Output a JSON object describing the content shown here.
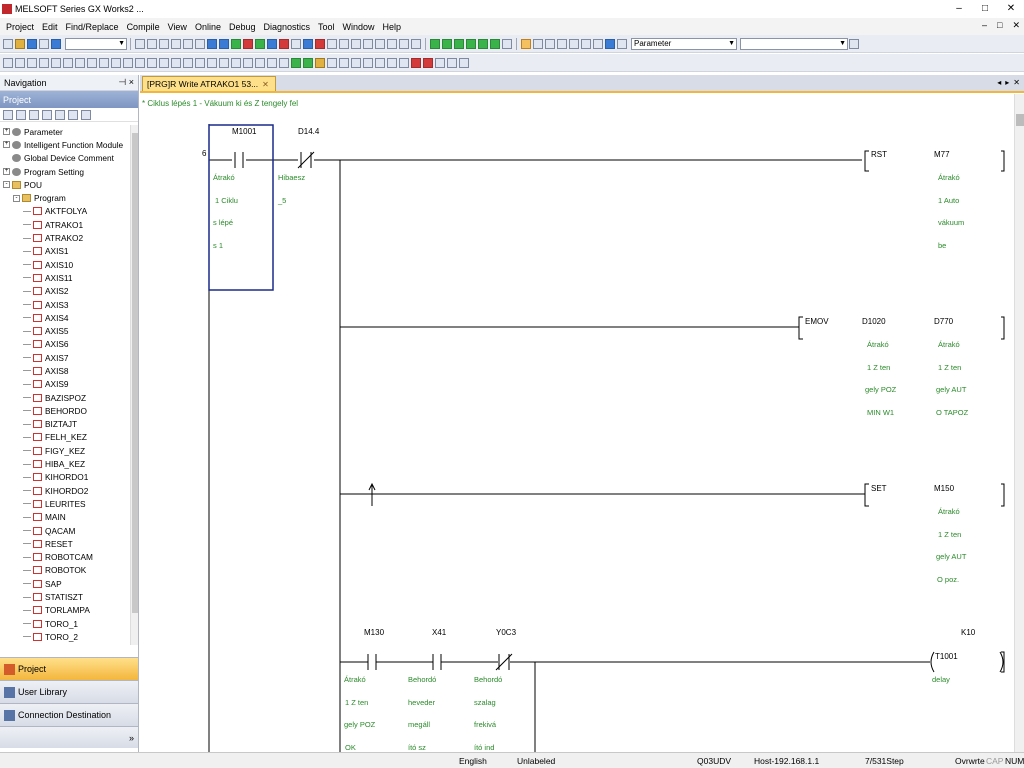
{
  "window": {
    "title": "MELSOFT Series GX Works2 ...",
    "controls": [
      "–",
      "□",
      "✕"
    ]
  },
  "menu": [
    "Project",
    "Edit",
    "Find/Replace",
    "Compile",
    "View",
    "Online",
    "Debug",
    "Diagnostics",
    "Tool",
    "Window",
    "Help"
  ],
  "menu_right": [
    "–",
    "□",
    "✕"
  ],
  "toolbar": {
    "parameter_combo": "Parameter",
    "empty_combo": ""
  },
  "navigation": {
    "title": "Navigation",
    "pin": "⊣ ×",
    "project_header": "Project",
    "tree": [
      {
        "label": "Parameter",
        "indent": 0,
        "icon": "gear",
        "expander": "+"
      },
      {
        "label": "Intelligent Function Module",
        "indent": 0,
        "icon": "gear",
        "expander": "+"
      },
      {
        "label": "Global Device Comment",
        "indent": 0,
        "icon": "gear",
        "expander": ""
      },
      {
        "label": "Program Setting",
        "indent": 0,
        "icon": "gear",
        "expander": "+"
      },
      {
        "label": "POU",
        "indent": 0,
        "icon": "folder",
        "expander": "-"
      },
      {
        "label": "Program",
        "indent": 1,
        "icon": "folder",
        "expander": "-"
      },
      {
        "label": "AKTFOLYA",
        "indent": 2,
        "icon": "prog",
        "expander": ""
      },
      {
        "label": "ATRAKO1",
        "indent": 2,
        "icon": "prog",
        "expander": ""
      },
      {
        "label": "ATRAKO2",
        "indent": 2,
        "icon": "prog",
        "expander": ""
      },
      {
        "label": "AXIS1",
        "indent": 2,
        "icon": "prog",
        "expander": ""
      },
      {
        "label": "AXIS10",
        "indent": 2,
        "icon": "prog",
        "expander": ""
      },
      {
        "label": "AXIS11",
        "indent": 2,
        "icon": "prog",
        "expander": ""
      },
      {
        "label": "AXIS2",
        "indent": 2,
        "icon": "prog",
        "expander": ""
      },
      {
        "label": "AXIS3",
        "indent": 2,
        "icon": "prog",
        "expander": ""
      },
      {
        "label": "AXIS4",
        "indent": 2,
        "icon": "prog",
        "expander": ""
      },
      {
        "label": "AXIS5",
        "indent": 2,
        "icon": "prog",
        "expander": ""
      },
      {
        "label": "AXIS6",
        "indent": 2,
        "icon": "prog",
        "expander": ""
      },
      {
        "label": "AXIS7",
        "indent": 2,
        "icon": "prog",
        "expander": ""
      },
      {
        "label": "AXIS8",
        "indent": 2,
        "icon": "prog",
        "expander": ""
      },
      {
        "label": "AXIS9",
        "indent": 2,
        "icon": "prog",
        "expander": ""
      },
      {
        "label": "BAZISPOZ",
        "indent": 2,
        "icon": "prog",
        "expander": ""
      },
      {
        "label": "BEHORDO",
        "indent": 2,
        "icon": "prog",
        "expander": ""
      },
      {
        "label": "BIZTAJT",
        "indent": 2,
        "icon": "prog",
        "expander": ""
      },
      {
        "label": "FELH_KEZ",
        "indent": 2,
        "icon": "prog",
        "expander": ""
      },
      {
        "label": "FIGY_KEZ",
        "indent": 2,
        "icon": "prog",
        "expander": ""
      },
      {
        "label": "HIBA_KEZ",
        "indent": 2,
        "icon": "prog",
        "expander": ""
      },
      {
        "label": "KIHORDO1",
        "indent": 2,
        "icon": "prog",
        "expander": ""
      },
      {
        "label": "KIHORDO2",
        "indent": 2,
        "icon": "prog",
        "expander": ""
      },
      {
        "label": "LEURITES",
        "indent": 2,
        "icon": "prog",
        "expander": ""
      },
      {
        "label": "MAIN",
        "indent": 2,
        "icon": "prog",
        "expander": ""
      },
      {
        "label": "QACAM",
        "indent": 2,
        "icon": "prog",
        "expander": ""
      },
      {
        "label": "RESET",
        "indent": 2,
        "icon": "prog",
        "expander": ""
      },
      {
        "label": "ROBOTCAM",
        "indent": 2,
        "icon": "prog",
        "expander": ""
      },
      {
        "label": "ROBOTOK",
        "indent": 2,
        "icon": "prog",
        "expander": ""
      },
      {
        "label": "SAP",
        "indent": 2,
        "icon": "prog",
        "expander": ""
      },
      {
        "label": "STATISZT",
        "indent": 2,
        "icon": "prog",
        "expander": ""
      },
      {
        "label": "TORLAMPA",
        "indent": 2,
        "icon": "prog",
        "expander": ""
      },
      {
        "label": "TORO_1",
        "indent": 2,
        "icon": "prog",
        "expander": ""
      },
      {
        "label": "TORO_2",
        "indent": 2,
        "icon": "prog",
        "expander": ""
      }
    ],
    "bottom_buttons": [
      "Project",
      "User Library",
      "Connection Destination"
    ],
    "footer_chevron": "»"
  },
  "tabs": [
    {
      "label": "[PRG]R Write ATRAKO1 53...",
      "close": "✕"
    }
  ],
  "tab_controls": [
    "◂",
    "▸",
    "✕"
  ],
  "ladder": {
    "comment": "* Ciklus lépés 1 - Vákuum ki és Z tengely fel",
    "step_number": "6",
    "contacts": [
      {
        "device": "M1001",
        "comment": [
          "Átrakó",
          "1 Ciklu",
          "s lépé",
          "s 1"
        ]
      },
      {
        "device": "D14.4",
        "comment": [
          "Hibaesz",
          "_5"
        ]
      },
      {
        "device": "M130",
        "comment": [
          "Átrakó",
          "1 Z ten",
          "gely POZ",
          "OK"
        ]
      },
      {
        "device": "X41",
        "comment": [
          "Behordó",
          "heveder",
          "megáll",
          "ító sz"
        ]
      },
      {
        "device": "Y0C3",
        "comment": [
          "Behordó",
          "szalag",
          "frekivá",
          "ító ind"
        ]
      }
    ],
    "instructions": [
      {
        "name": "RST",
        "operand": "M77",
        "comment": [
          "Átrakó",
          "1 Auto",
          "vákuum",
          "be"
        ]
      },
      {
        "name": "EMOV",
        "operand1": "D1020",
        "operand2": "D770",
        "comment1": [
          "Átrakó",
          "1 Z ten",
          "gely POZ",
          "MIN W1"
        ],
        "comment2": [
          "Átrakó",
          "1 Z ten",
          "gely AUT",
          "O TAPOZ"
        ]
      },
      {
        "name": "SET",
        "operand": "M150",
        "comment": [
          "Átrakó",
          "1 Z ten",
          "gely AUT",
          "O poz."
        ]
      }
    ],
    "coil": {
      "device": "T1001",
      "setting": "K10",
      "comment": [
        "delay"
      ]
    }
  },
  "status": {
    "language": "English",
    "label": "Unlabeled",
    "cpu": "Q03UDV",
    "host": "Host-192.168.1.1",
    "step": "7/531Step",
    "mode": "Ovrwrte",
    "caps": "CAP",
    "num": "NUM"
  }
}
